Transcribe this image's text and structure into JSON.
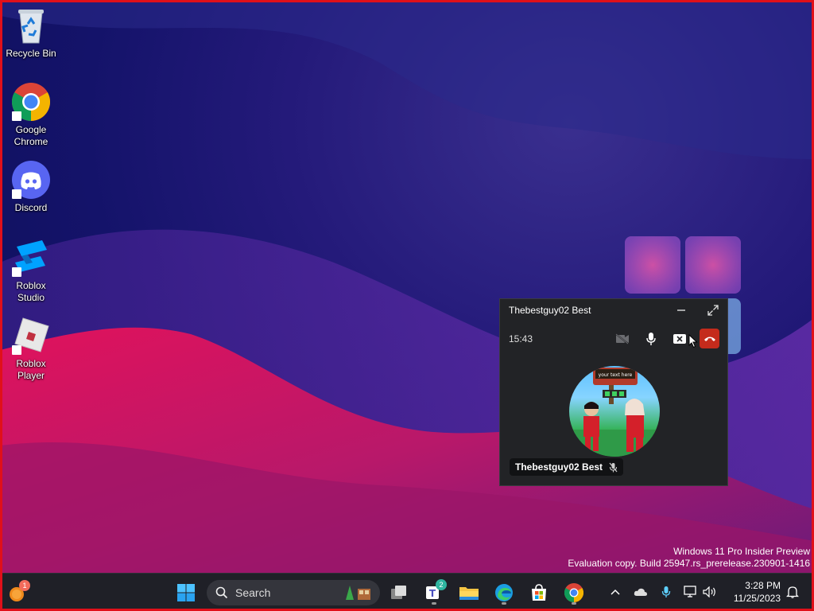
{
  "desktop": {
    "icons": [
      {
        "label": "Recycle Bin",
        "icon": "recycle-bin-icon"
      },
      {
        "label": "Google Chrome",
        "icon": "chrome-icon"
      },
      {
        "label": "Discord",
        "icon": "discord-icon"
      },
      {
        "label": "Roblox Studio",
        "icon": "roblox-studio-icon"
      },
      {
        "label": "Roblox Player",
        "icon": "roblox-player-icon"
      }
    ],
    "watermark": {
      "line1": "Windows 11 Pro Insider Preview",
      "line2": "Evaluation copy. Build 25947.rs_prerelease.230901-1416"
    }
  },
  "call_window": {
    "title": "Thebestguy02 Best",
    "timer": "15:43",
    "participant_name": "Thebestguy02 Best",
    "avatar_sign": "your text here",
    "colors": {
      "end_call": "#c42b1c",
      "background": "#222326"
    }
  },
  "taskbar": {
    "search_label": "Search",
    "teams_badge": "2",
    "widgets_badge": "1",
    "clock_time": "3:28 PM",
    "clock_date": "11/25/2023"
  }
}
